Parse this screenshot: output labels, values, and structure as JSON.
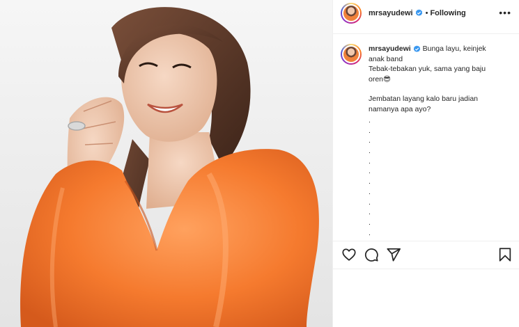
{
  "post": {
    "username": "mrsayudewi",
    "separator": "•",
    "follow_status": "Following",
    "more_label": "•••",
    "caption": {
      "line1": "Bunga layu, keinjek",
      "line2": "anak band",
      "line3": "Tebak-tebakan yuk, sama yang baju",
      "line4": "oren😎",
      "line5": "Jembatan layang kalo baru jadian",
      "line6": "namanya apa ayo?",
      "dots": [
        ".",
        ".",
        ".",
        ".",
        ".",
        ".",
        ".",
        ".",
        ".",
        ".",
        ".",
        "."
      ]
    },
    "icons": {
      "verified": "verified-badge-icon",
      "like": "heart-icon",
      "comment": "comment-icon",
      "share": "send-icon",
      "save": "bookmark-icon"
    }
  },
  "colors": {
    "text": "#262626",
    "verified_blue": "#3897f0",
    "border": "#efefef",
    "dress_orange": "#f57a2e"
  }
}
